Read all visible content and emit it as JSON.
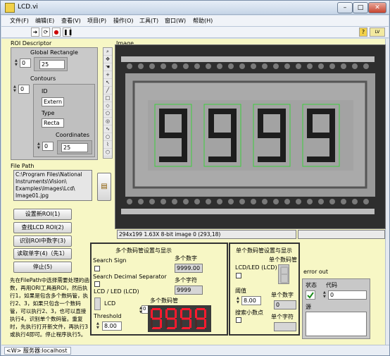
{
  "window": {
    "title": "LCD.vi",
    "minimize": "–",
    "maximize": "□",
    "close": "✕"
  },
  "menu": [
    "文件(F)",
    "编辑(E)",
    "查看(V)",
    "项目(P)",
    "操作(O)",
    "工具(T)",
    "窗口(W)",
    "帮助(H)"
  ],
  "toolbar": {
    "run": "➜",
    "run_cont": "⟳",
    "abort": "●",
    "pause": "❚❚",
    "help": "?"
  },
  "roi": {
    "title": "ROI Descriptor",
    "global_rect_label": "Global Rectangle",
    "index1": "0",
    "global_rect_value": "25",
    "contours_label": "Contours",
    "index2": "0",
    "id_label": "ID",
    "id_value": "Extern",
    "type_label": "Type",
    "type_value": "Recta",
    "coords_label": "Coordinates",
    "coords_index": "0",
    "coords_value": "25"
  },
  "filepath": {
    "label": "File Path",
    "value": "C:\\Program Files\\National Instruments\\Vision\\ Examples\\Images\\Lcd\\ Image01.jpg",
    "browse_icon": "folder-icon"
  },
  "buttons": [
    "设置新ROI(1)",
    "查找LCD ROI(2)",
    "识别ROI中数字(3)",
    "读取单字(4)（先1）",
    "停止(5)"
  ],
  "instructions": "先在FilePath中选择需要处理的函数，再用ORI工具画ROI，然后执行1，如果是包含多个数码管，执行2、3，如果只包含一个数码管，可以执行2、3，也可以直接执行4，识别单个数码管。重复时，先执行打开新文件，再执行3或执行4即可。停止程序执行5。",
  "image": {
    "label": "Image",
    "info": "294x199 1.63X 8-bit image 0     (293,18)",
    "digits": [
      "9",
      "9",
      "9",
      "9"
    ]
  },
  "tools_icons": [
    "zoom-icon",
    "pan-icon",
    "hand-icon",
    "crosshair-icon",
    "pointer-icon",
    "line-icon",
    "rect-icon",
    "rotated-rect-icon",
    "polygon-icon",
    "annulus-icon",
    "freehand-icon",
    "oval-icon",
    "broken-line-icon",
    "polyline-icon",
    "circle-icon"
  ],
  "multi": {
    "title": "多个数码管设置与显示",
    "search_sign": "Search Sign",
    "search_decimal": "Search Decimal Separator",
    "lcd_led_label": "LCD / LED (LCD)",
    "lcd_text": "LCD",
    "threshold_label": "Threshold",
    "threshold_value": "8.00",
    "multi_num_label": "多个数字",
    "multi_num_value": "9999.00",
    "multi_char_label": "多个字符",
    "multi_char_value": "9999",
    "multi_led_label": "多个数码管",
    "led_index": "0",
    "led_digits": [
      "9",
      "9",
      "9",
      "9"
    ]
  },
  "single": {
    "title": "单个数码管设置与显示",
    "lcd_led_label": "LCD/LED (LCD)",
    "single_led_label": "单个数码管",
    "threshold_label": "阈值",
    "threshold_value": "8.00",
    "single_num_label": "单个数字",
    "single_num_value": "0",
    "decimal_label": "搜索小数点",
    "single_char_label": "单个字符"
  },
  "error": {
    "title": "error out",
    "status_label": "状态",
    "code_label": "代码",
    "code_value": "0",
    "source_label": "源"
  },
  "status": {
    "server": "<W> 服务器:localhost"
  }
}
